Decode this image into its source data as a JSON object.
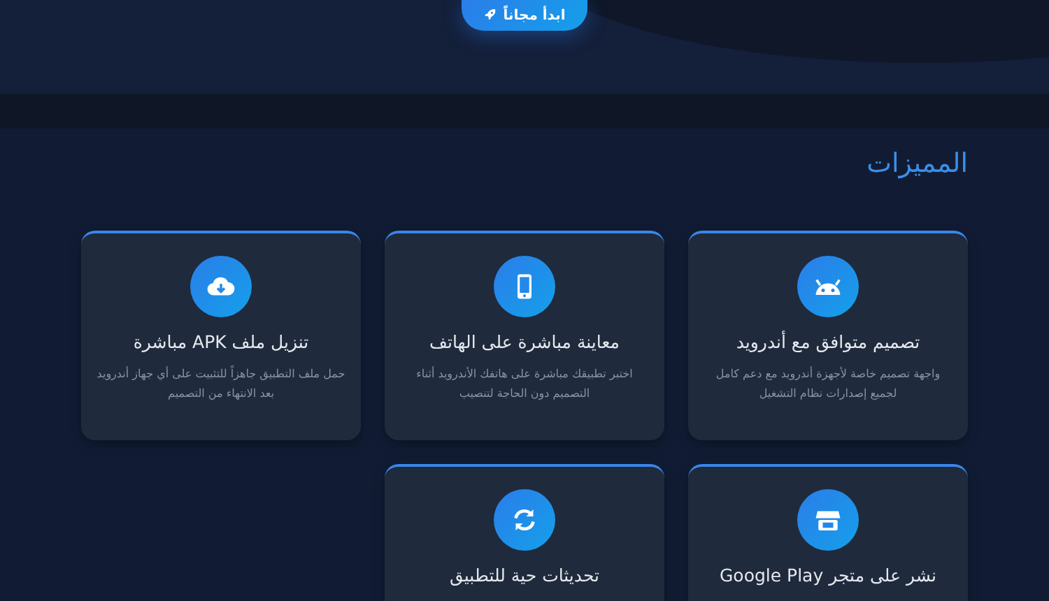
{
  "hero": {
    "button": {
      "label": "ابدأ مجاناً"
    }
  },
  "features": {
    "title": "المميزات",
    "cards": [
      {
        "title": "تصميم متوافق مع أندرويد",
        "description": "واجهة تصميم خاصة لأجهزة أندرويد مع دعم كامل لجميع إصدارات نظام التشغيل"
      },
      {
        "title": "معاينة مباشرة على الهاتف",
        "description": "اختبر تطبيقك مباشرة على هاتفك الأندرويد أثناء التصميم دون الحاجة لتنصيب"
      },
      {
        "title": "تنزيل ملف APK مباشرة",
        "description": "حمل ملف التطبيق جاهزاً للتثبيت على أي جهاز أندرويد بعد الانتهاء من التصميم"
      },
      {
        "title": "نشر على متجر Google Play"
      },
      {
        "title": "تحديثات حية للتطبيق"
      }
    ]
  }
}
